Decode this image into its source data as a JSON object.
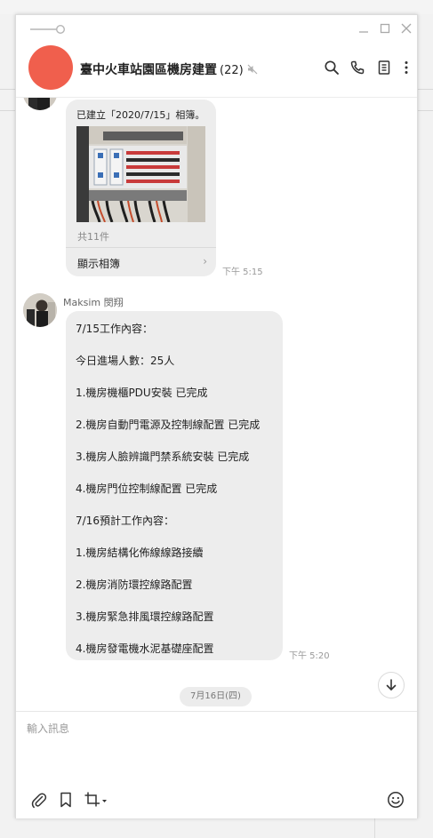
{
  "chat": {
    "title": "臺中火車站園區機房建置",
    "member_count": "(22)",
    "avatar_color": "#f05f4d"
  },
  "icons": {
    "header": [
      "search-icon",
      "phone-icon",
      "notes-icon",
      "more-icon"
    ],
    "toolbar": [
      "paperclip-icon",
      "bookmark-icon",
      "crop-icon",
      "emoji-icon"
    ],
    "window": [
      "pin-icon",
      "minimize-icon",
      "maximize-icon",
      "close-icon"
    ]
  },
  "messages": {
    "album": {
      "caption": "已建立「2020/7/15」相簿。",
      "count": "共11件",
      "show_label": "顯示相簿",
      "time": "下午 5:15"
    },
    "text_message": {
      "sender": "Maksim 閔翔",
      "time": "下午 5:20",
      "lines": [
        "7/15工作內容：",
        "今日進場人數：25人",
        "1.機房機櫃PDU安裝 已完成",
        "2.機房自動門電源及控制線配置 已完成",
        "3.機房人臉辨識門禁系統安裝 已完成",
        "4.機房門位控制線配置 已完成",
        "7/16預計工作內容：",
        "1.機房結構化佈線線路接續",
        "2.機房消防環控線路配置",
        "3.機房緊急排風環控線路配置",
        "4.機房發電機水泥基礎座配置"
      ]
    },
    "date_separator": "7月16日(四)"
  },
  "input": {
    "placeholder": "輸入訊息"
  },
  "colors": {
    "bubble": "#ededed",
    "accent_avatar": "#f05f4d"
  }
}
